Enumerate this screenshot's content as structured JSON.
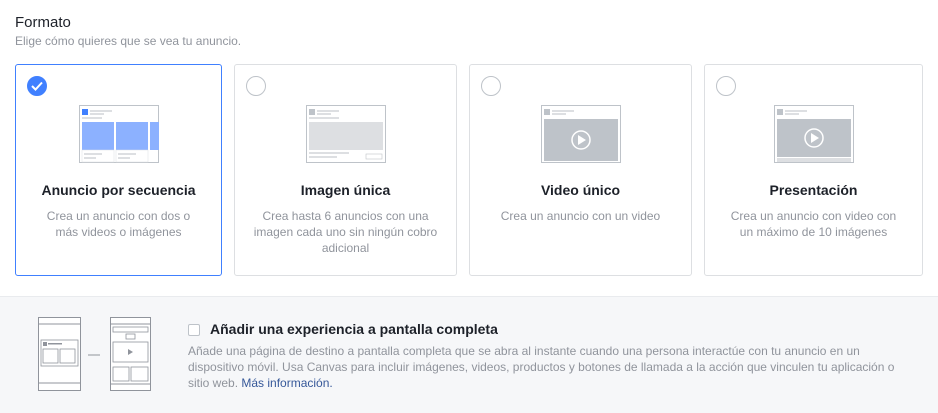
{
  "format": {
    "title": "Formato",
    "subtitle": "Elige cómo quieres que se vea tu anuncio."
  },
  "cards": [
    {
      "title": "Anuncio por secuencia",
      "desc": "Crea un anuncio con dos o más videos o imágenes",
      "selected": true
    },
    {
      "title": "Imagen única",
      "desc": "Crea hasta 6 anuncios con una imagen cada uno sin ningún cobro adicional",
      "selected": false
    },
    {
      "title": "Video único",
      "desc": "Crea un anuncio con un video",
      "selected": false
    },
    {
      "title": "Presentación",
      "desc": "Crea un anuncio con video con un máximo de 10 imágenes",
      "selected": false
    }
  ],
  "canvas": {
    "title": "Añadir una experiencia a pantalla completa",
    "desc": "Añade una página de destino a pantalla completa que se abra al instante cuando una persona interactúe con tu anuncio en un dispositivo móvil. Usa Canvas para incluir imágenes, videos, productos y botones de llamada a la acción que vinculen tu aplicación o sitio web.",
    "link": "Más información."
  },
  "colors": {
    "accent": "#4080ff",
    "link": "#365899",
    "muted": "#90949c"
  }
}
